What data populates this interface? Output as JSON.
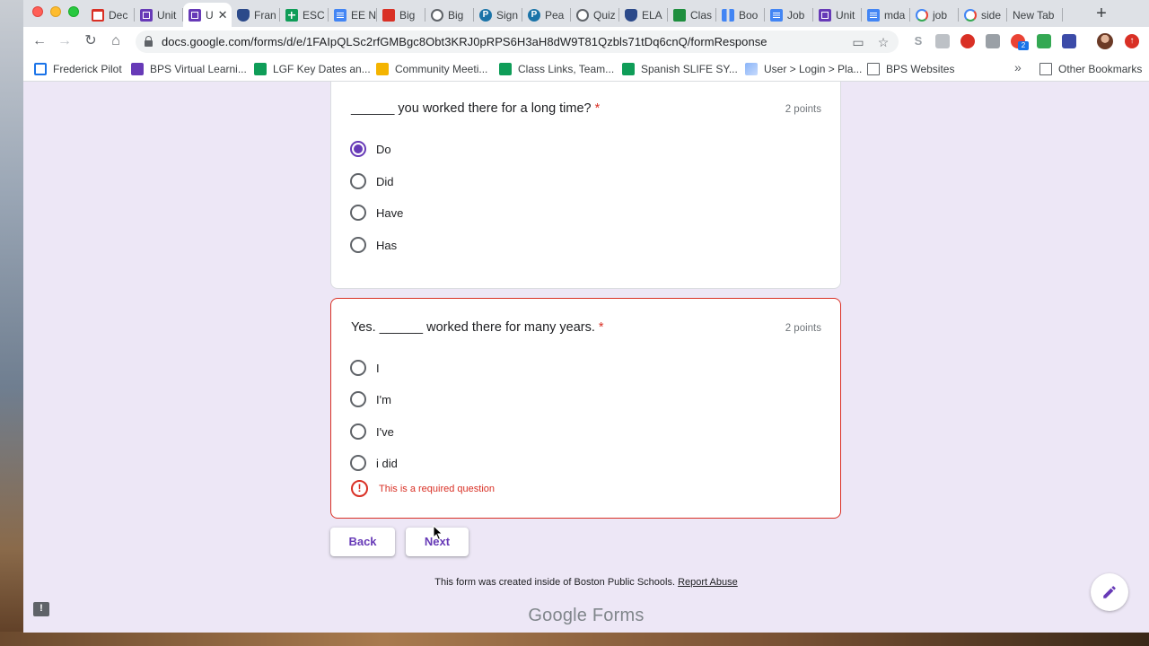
{
  "browser": {
    "tabs": [
      {
        "label": "Dec",
        "icon": "gmail-icon"
      },
      {
        "label": "Unit",
        "icon": "forms-icon"
      },
      {
        "label": "U",
        "icon": "forms-icon",
        "active": true
      },
      {
        "label": "Fran",
        "icon": "shield-icon"
      },
      {
        "label": "ESC",
        "icon": "sheets-icon"
      },
      {
        "label": "EE N",
        "icon": "docs-icon"
      },
      {
        "label": "Big",
        "icon": "pdf-icon"
      },
      {
        "label": "Big",
        "icon": "globe-icon"
      },
      {
        "label": "Sign",
        "icon": "p-icon"
      },
      {
        "label": "Pea",
        "icon": "p-icon"
      },
      {
        "label": "Quiz",
        "icon": "globe-icon"
      },
      {
        "label": "ELA",
        "icon": "shield-icon"
      },
      {
        "label": "Clas",
        "icon": "classroom-icon"
      },
      {
        "label": "Boo",
        "icon": "chart-icon"
      },
      {
        "label": "Job",
        "icon": "docs-icon"
      },
      {
        "label": "Unit",
        "icon": "forms-icon"
      },
      {
        "label": "mda",
        "icon": "docs-icon"
      },
      {
        "label": "job",
        "icon": "google-icon"
      },
      {
        "label": "side",
        "icon": "google-icon"
      },
      {
        "label": "New Tab",
        "icon": ""
      }
    ],
    "url": "docs.google.com/forms/d/e/1FAIpQLSc2rfGMBgc8Obt3KRJ0pRPS6H3aH8dW9T81Qzbls71tDq6cnQ/formResponse",
    "bookmarks": [
      {
        "label": "Frederick Pilot"
      },
      {
        "label": "BPS Virtual Learni..."
      },
      {
        "label": "LGF Key Dates an..."
      },
      {
        "label": "Community Meeti..."
      },
      {
        "label": "Class Links, Team..."
      },
      {
        "label": "Spanish SLIFE SY..."
      },
      {
        "label": "User > Login > Pla..."
      },
      {
        "label": "BPS Websites"
      }
    ],
    "other_bookmarks": "Other Bookmarks",
    "overflow_chevron": "»",
    "extension_badge": "2"
  },
  "form": {
    "questions": [
      {
        "title": "______ you worked there for a long time?",
        "required_mark": "*",
        "points": "2 points",
        "options": [
          "Do",
          "Did",
          "Have",
          "Has"
        ],
        "selected": "Do"
      },
      {
        "title": "Yes. ______ worked there for many years.",
        "required_mark": "*",
        "points": "2 points",
        "options": [
          "I",
          "I'm",
          "I've",
          "i did"
        ],
        "selected": null,
        "error": "This is a required question"
      }
    ],
    "back_label": "Back",
    "next_label": "Next",
    "footer_text": "This form was created inside of Boston Public Schools.",
    "report_abuse": "Report Abuse",
    "brand_google": "Google",
    "brand_forms": "Forms"
  },
  "colors": {
    "accent": "#673ab7",
    "error": "#d93025",
    "page_bg": "#ede7f6"
  }
}
